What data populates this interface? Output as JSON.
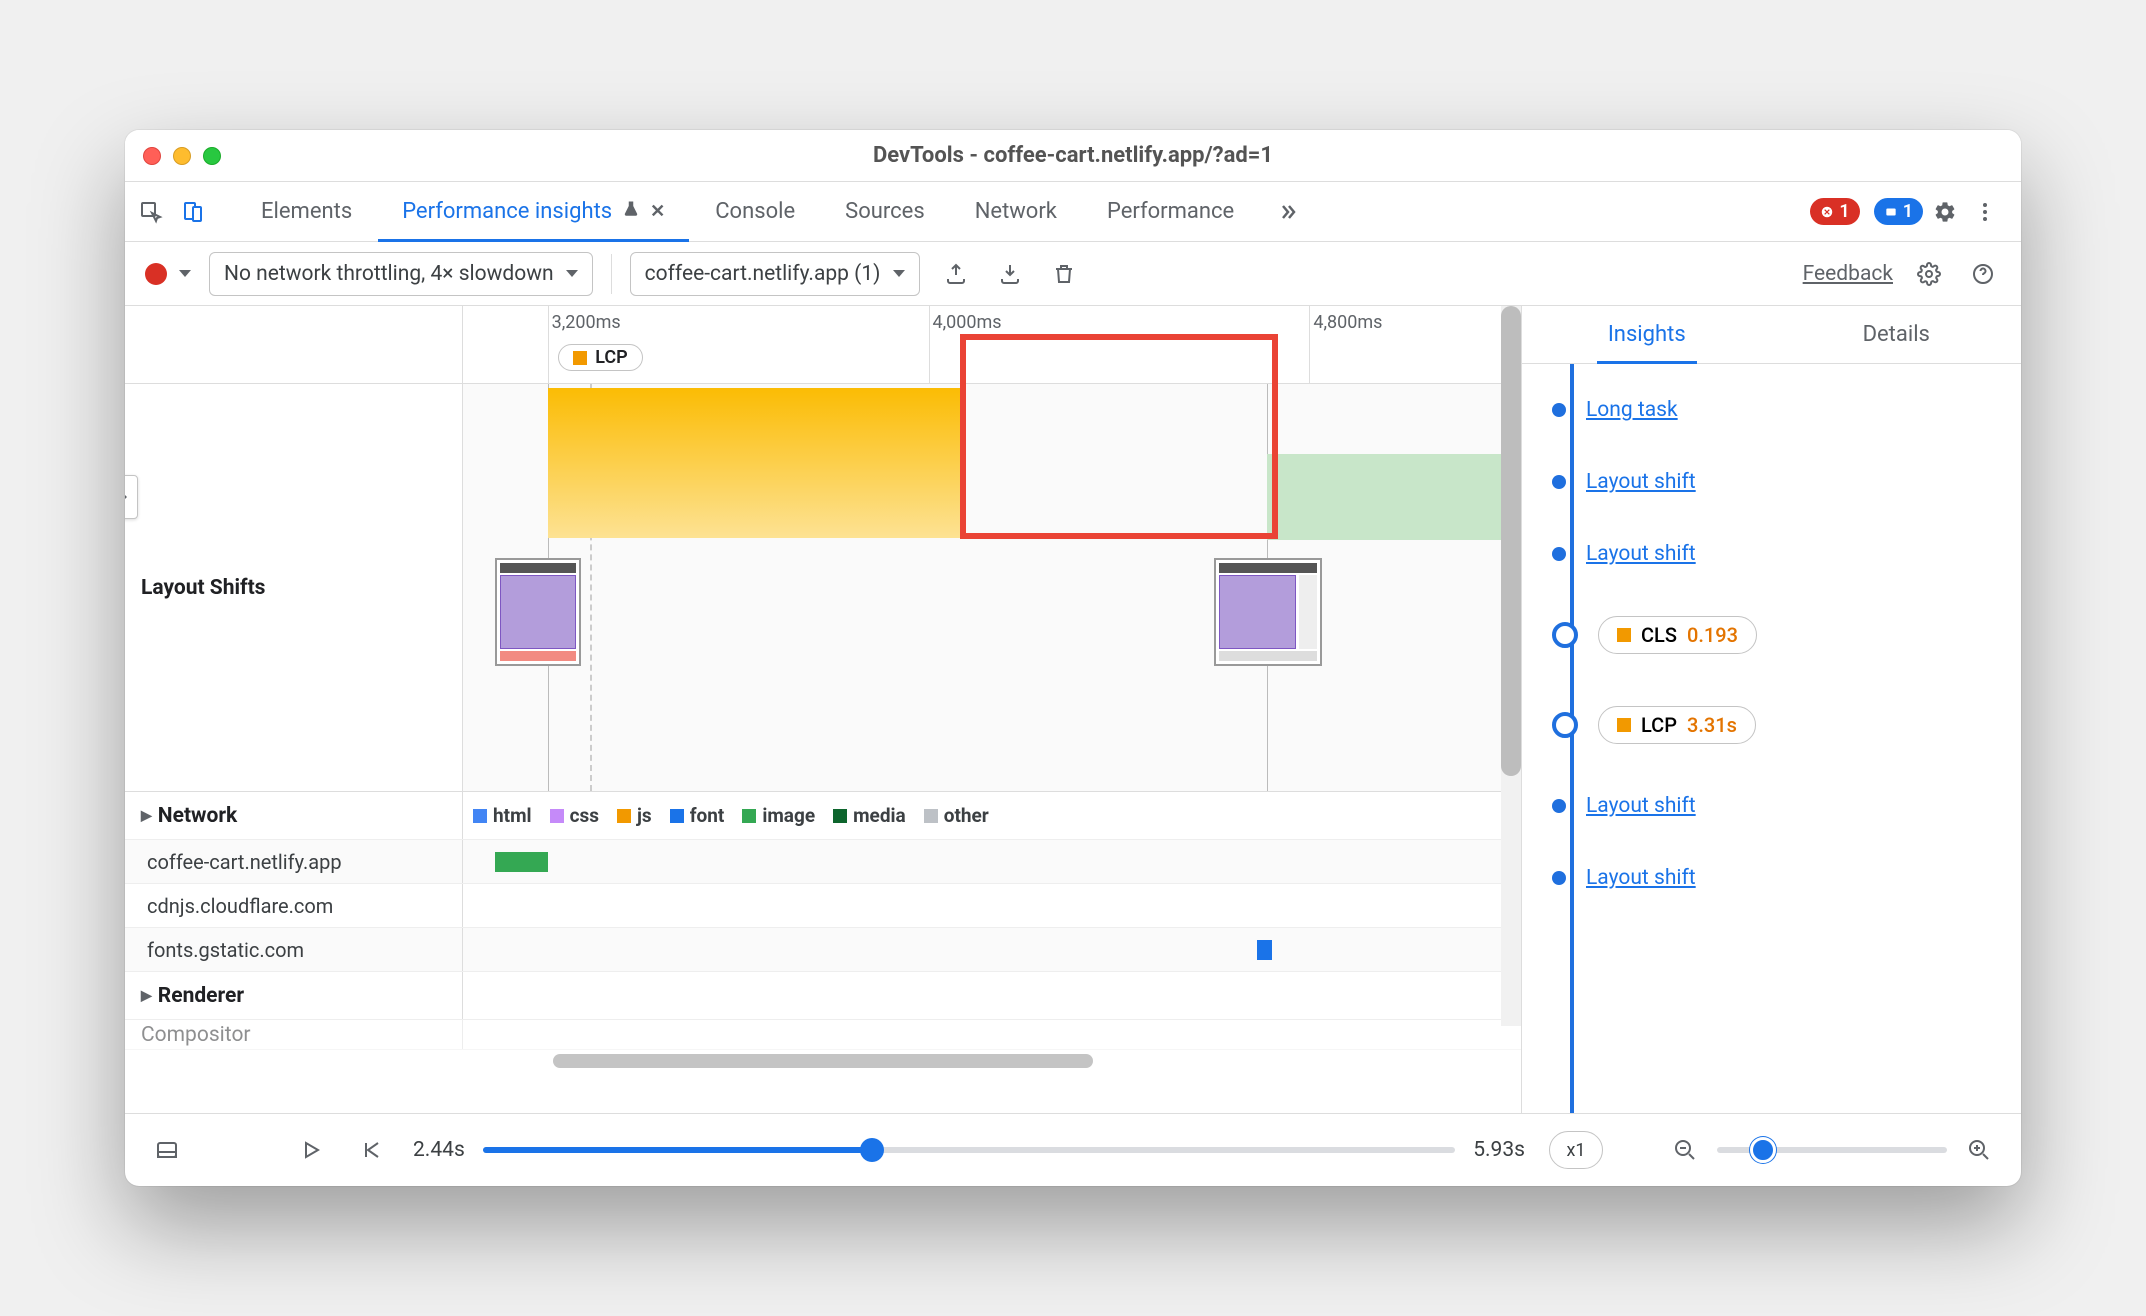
{
  "window": {
    "title": "DevTools - coffee-cart.netlify.app/?ad=1"
  },
  "tabs": {
    "elements": "Elements",
    "perf_insights": "Performance insights",
    "console": "Console",
    "sources": "Sources",
    "network": "Network",
    "performance": "Performance",
    "error_count": "1",
    "issue_count": "1"
  },
  "subbar": {
    "throttling": "No network throttling, 4× slowdown",
    "recording": "coffee-cart.netlify.app (1)",
    "feedback": "Feedback"
  },
  "timeline": {
    "ticks": [
      "3,200ms",
      "4,000ms",
      "4,800ms"
    ],
    "lcp_chip": "LCP"
  },
  "tracks": {
    "layout_shifts": "Layout Shifts",
    "network": "Network",
    "renderer": "Renderer",
    "compositor": "Compositor",
    "legend": {
      "html": "html",
      "css": "css",
      "js": "js",
      "font": "font",
      "image": "image",
      "media": "media",
      "other": "other"
    },
    "hosts": [
      "coffee-cart.netlify.app",
      "cdnjs.cloudflare.com",
      "fonts.gstatic.com"
    ]
  },
  "insights": {
    "tab_insights": "Insights",
    "tab_details": "Details",
    "items": [
      {
        "type": "link",
        "label": "Long task"
      },
      {
        "type": "link",
        "label": "Layout shift"
      },
      {
        "type": "link",
        "label": "Layout shift"
      },
      {
        "type": "metric",
        "name": "CLS",
        "value": "0.193",
        "color": "orange"
      },
      {
        "type": "metric",
        "name": "LCP",
        "value": "3.31s",
        "color": "orange"
      },
      {
        "type": "link",
        "label": "Layout shift"
      },
      {
        "type": "link",
        "label": "Layout shift"
      }
    ]
  },
  "playback": {
    "start": "2.44s",
    "end": "5.93s",
    "speed": "x1"
  }
}
